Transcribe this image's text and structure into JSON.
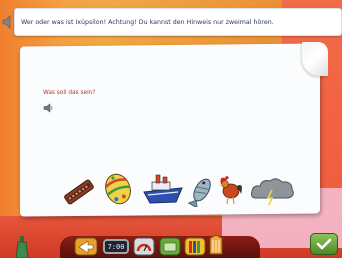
{
  "instruction": {
    "text": "Wer oder was ist Ixüpsilon! Achtung! Du kannst den Hinweis nur zweimal hören."
  },
  "question": {
    "text": "Was soll das sein?"
  },
  "objects": [
    {
      "name": "harmonica"
    },
    {
      "name": "easter-egg"
    },
    {
      "name": "ship"
    },
    {
      "name": "fish"
    },
    {
      "name": "rooster"
    },
    {
      "name": "thunder-cloud"
    }
  ],
  "toolbar": {
    "clock_display": "7:00"
  },
  "colors": {
    "question_text": "#b33a2a",
    "instruction_text": "#2a3a6a",
    "check_green": "#6aa83c"
  }
}
